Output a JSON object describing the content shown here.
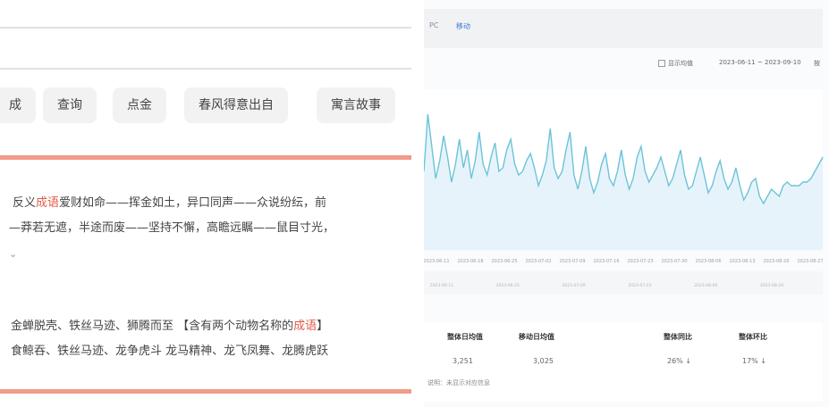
{
  "left_panel": {
    "tabs": [
      {
        "label": "成"
      },
      {
        "label": "查询"
      },
      {
        "label": "点金"
      },
      {
        "label": "春风得意出自"
      },
      {
        "label": "寓言故事"
      }
    ],
    "result1": {
      "line1_parts": [
        "反义",
        "成语",
        "爱财如命——挥金如土，异口同声——众说纷纭，前"
      ],
      "line2": "—莽若无遮，半途而废——坚持不懈，高瞻远瞩——鼠目寸光，"
    },
    "result2": {
      "line1_parts": [
        "金蝉脱壳、铁丝马迹、狮腾而至 【含有两个动物名称的",
        "成语",
        "】"
      ],
      "line2": "食鲸吞、铁丝马迹、龙争虎斗 龙马精神、龙飞凤舞、龙腾虎跃"
    },
    "colors": {
      "highlight": "#e05a4a",
      "divider": "#f19b8a"
    }
  },
  "right_panel": {
    "header_tabs": [
      "PC",
      "移动"
    ],
    "controls": {
      "checkbox_label": "显示均值",
      "date_range": "2023-06-11 ~ 2023-09-10",
      "more": "按"
    },
    "summary": {
      "headers": [
        "整体日均值",
        "移动日均值",
        "整体同比",
        "整体环比"
      ],
      "values": [
        "3,251",
        "3,025",
        "26% ↓",
        "17% ↓"
      ],
      "note": "说明：未显示对应信息"
    }
  },
  "chart_data": {
    "type": "line",
    "x_tick_labels": [
      "2023-06-11",
      "2023-06-18",
      "2023-06-25",
      "2023-07-02",
      "2023-07-09",
      "2023-07-16",
      "2023-07-23",
      "2023-07-30",
      "2023-08-06",
      "2023-08-13",
      "2023-08-20",
      "2023-08-27"
    ],
    "series": [
      {
        "values": [
          5200,
          6800,
          5900,
          5000,
          5500,
          6200,
          5600,
          4900,
          5400,
          6100,
          5300,
          5800,
          5000,
          5500,
          6300,
          5400,
          5100,
          5600,
          6000,
          5200,
          5300,
          5800,
          6100,
          5400,
          5100,
          5200,
          5500,
          5700,
          5300,
          4800,
          5100,
          5500,
          6400,
          5300,
          5000,
          5200,
          5800,
          6300,
          5100,
          4700,
          5200,
          5900,
          5000,
          4600,
          4900,
          5400,
          5700,
          5000,
          4800,
          5200,
          5800,
          5100,
          4700,
          5000,
          5600,
          5900,
          5200,
          4900,
          5100,
          5300,
          5600,
          5200,
          4800,
          5000,
          5400,
          5800,
          5100,
          4700,
          4800,
          5200,
          5600,
          5100,
          4600,
          4800,
          5200,
          5500,
          5000,
          4700,
          4900,
          5300,
          4800,
          4400,
          4600,
          4900,
          5000,
          4500,
          4300,
          4500,
          4700,
          4600,
          4500,
          4800,
          4900,
          4800,
          4800,
          4800,
          4900,
          4900,
          5000,
          5200,
          5400,
          5600
        ]
      }
    ],
    "ylim": [
      3000,
      7500
    ],
    "color": "#6cc4d8",
    "fill": "#e7f3fb",
    "grid": false
  }
}
